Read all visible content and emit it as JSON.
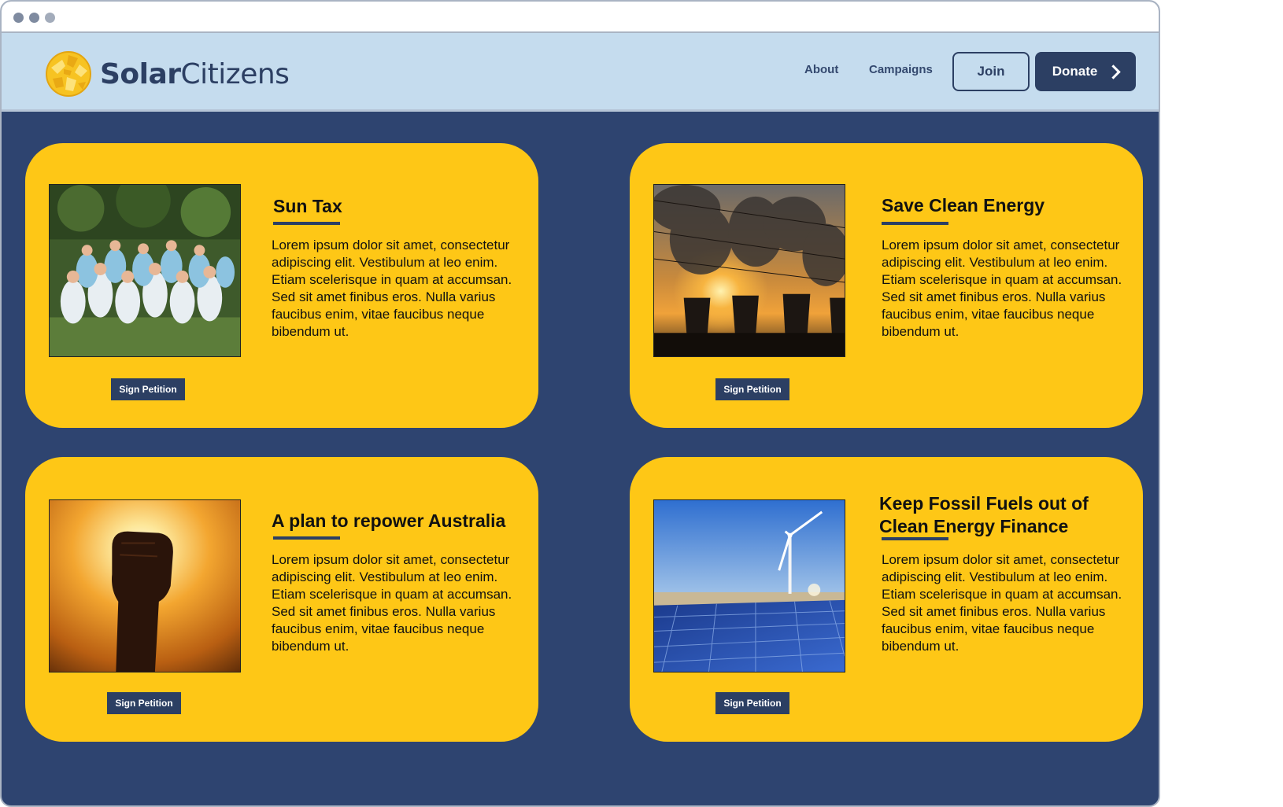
{
  "brand": {
    "name_bold": "Solar",
    "name_light": "Citizens",
    "logo_color": "#f5b820"
  },
  "nav": {
    "about_label": "About",
    "campaigns_label": "Campaigns",
    "join_label": "Join",
    "donate_label": "Donate"
  },
  "colors": {
    "navy": "#2c3f63",
    "card_yellow": "#fec716",
    "page_background": "#2e4470",
    "header_background": "#c5dcee"
  },
  "campaigns": [
    {
      "title": "Sun Tax",
      "body": "Lorem ipsum dolor sit amet, consectetur adipiscing elit. Vestibulum at leo enim. Etiam scelerisque in quam at accumsan. Sed sit amet finibus eros. Nulla varius faucibus enim, vitae faucibus neque bibendum ut.",
      "button_label": "Sign Petition",
      "image": "crowd-of-supporters-photo"
    },
    {
      "title": "Save Clean Energy",
      "body": "Lorem ipsum dolor sit amet, consectetur adipiscing elit. Vestibulum at leo enim. Etiam scelerisque in quam at accumsan. Sed sit amet finibus eros. Nulla varius faucibus enim, vitae faucibus neque bibendum ut.",
      "button_label": "Sign Petition",
      "image": "power-plant-smoke-sunset-photo"
    },
    {
      "title": "A plan to repower Australia",
      "body": "Lorem ipsum dolor sit amet, consectetur adipiscing elit. Vestibulum at leo enim. Etiam scelerisque in quam at accumsan. Sed sit amet finibus eros. Nulla varius faucibus enim, vitae faucibus neque bibendum ut.",
      "button_label": "Sign Petition",
      "image": "raised-fist-sunset-photo"
    },
    {
      "title": "Keep Fossil Fuels out of Clean Energy Finance",
      "body": "Lorem ipsum dolor sit amet, consectetur adipiscing elit. Vestibulum at leo enim. Etiam scelerisque in quam at accumsan. Sed sit amet finibus eros. Nulla varius faucibus enim, vitae faucibus neque bibendum ut.",
      "button_label": "Sign Petition",
      "image": "wind-turbine-solar-panels-photo"
    }
  ]
}
